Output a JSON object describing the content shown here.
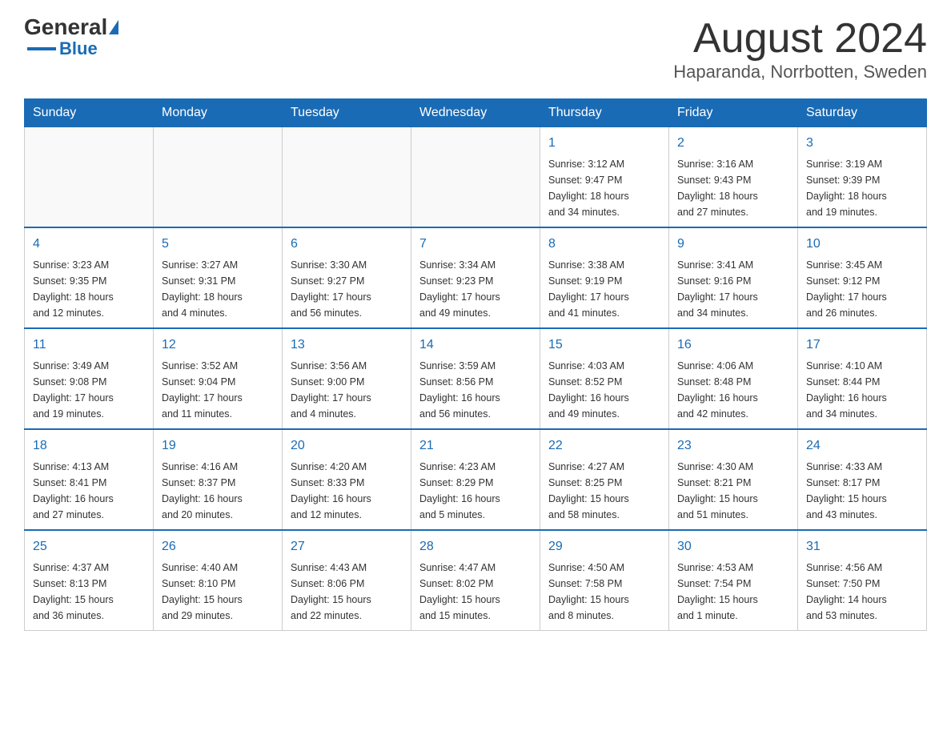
{
  "header": {
    "logo_general": "General",
    "logo_blue": "Blue",
    "month_title": "August 2024",
    "location": "Haparanda, Norrbotten, Sweden"
  },
  "weekdays": [
    "Sunday",
    "Monday",
    "Tuesday",
    "Wednesday",
    "Thursday",
    "Friday",
    "Saturday"
  ],
  "weeks": [
    [
      {
        "day": "",
        "info": ""
      },
      {
        "day": "",
        "info": ""
      },
      {
        "day": "",
        "info": ""
      },
      {
        "day": "",
        "info": ""
      },
      {
        "day": "1",
        "info": "Sunrise: 3:12 AM\nSunset: 9:47 PM\nDaylight: 18 hours\nand 34 minutes."
      },
      {
        "day": "2",
        "info": "Sunrise: 3:16 AM\nSunset: 9:43 PM\nDaylight: 18 hours\nand 27 minutes."
      },
      {
        "day": "3",
        "info": "Sunrise: 3:19 AM\nSunset: 9:39 PM\nDaylight: 18 hours\nand 19 minutes."
      }
    ],
    [
      {
        "day": "4",
        "info": "Sunrise: 3:23 AM\nSunset: 9:35 PM\nDaylight: 18 hours\nand 12 minutes."
      },
      {
        "day": "5",
        "info": "Sunrise: 3:27 AM\nSunset: 9:31 PM\nDaylight: 18 hours\nand 4 minutes."
      },
      {
        "day": "6",
        "info": "Sunrise: 3:30 AM\nSunset: 9:27 PM\nDaylight: 17 hours\nand 56 minutes."
      },
      {
        "day": "7",
        "info": "Sunrise: 3:34 AM\nSunset: 9:23 PM\nDaylight: 17 hours\nand 49 minutes."
      },
      {
        "day": "8",
        "info": "Sunrise: 3:38 AM\nSunset: 9:19 PM\nDaylight: 17 hours\nand 41 minutes."
      },
      {
        "day": "9",
        "info": "Sunrise: 3:41 AM\nSunset: 9:16 PM\nDaylight: 17 hours\nand 34 minutes."
      },
      {
        "day": "10",
        "info": "Sunrise: 3:45 AM\nSunset: 9:12 PM\nDaylight: 17 hours\nand 26 minutes."
      }
    ],
    [
      {
        "day": "11",
        "info": "Sunrise: 3:49 AM\nSunset: 9:08 PM\nDaylight: 17 hours\nand 19 minutes."
      },
      {
        "day": "12",
        "info": "Sunrise: 3:52 AM\nSunset: 9:04 PM\nDaylight: 17 hours\nand 11 minutes."
      },
      {
        "day": "13",
        "info": "Sunrise: 3:56 AM\nSunset: 9:00 PM\nDaylight: 17 hours\nand 4 minutes."
      },
      {
        "day": "14",
        "info": "Sunrise: 3:59 AM\nSunset: 8:56 PM\nDaylight: 16 hours\nand 56 minutes."
      },
      {
        "day": "15",
        "info": "Sunrise: 4:03 AM\nSunset: 8:52 PM\nDaylight: 16 hours\nand 49 minutes."
      },
      {
        "day": "16",
        "info": "Sunrise: 4:06 AM\nSunset: 8:48 PM\nDaylight: 16 hours\nand 42 minutes."
      },
      {
        "day": "17",
        "info": "Sunrise: 4:10 AM\nSunset: 8:44 PM\nDaylight: 16 hours\nand 34 minutes."
      }
    ],
    [
      {
        "day": "18",
        "info": "Sunrise: 4:13 AM\nSunset: 8:41 PM\nDaylight: 16 hours\nand 27 minutes."
      },
      {
        "day": "19",
        "info": "Sunrise: 4:16 AM\nSunset: 8:37 PM\nDaylight: 16 hours\nand 20 minutes."
      },
      {
        "day": "20",
        "info": "Sunrise: 4:20 AM\nSunset: 8:33 PM\nDaylight: 16 hours\nand 12 minutes."
      },
      {
        "day": "21",
        "info": "Sunrise: 4:23 AM\nSunset: 8:29 PM\nDaylight: 16 hours\nand 5 minutes."
      },
      {
        "day": "22",
        "info": "Sunrise: 4:27 AM\nSunset: 8:25 PM\nDaylight: 15 hours\nand 58 minutes."
      },
      {
        "day": "23",
        "info": "Sunrise: 4:30 AM\nSunset: 8:21 PM\nDaylight: 15 hours\nand 51 minutes."
      },
      {
        "day": "24",
        "info": "Sunrise: 4:33 AM\nSunset: 8:17 PM\nDaylight: 15 hours\nand 43 minutes."
      }
    ],
    [
      {
        "day": "25",
        "info": "Sunrise: 4:37 AM\nSunset: 8:13 PM\nDaylight: 15 hours\nand 36 minutes."
      },
      {
        "day": "26",
        "info": "Sunrise: 4:40 AM\nSunset: 8:10 PM\nDaylight: 15 hours\nand 29 minutes."
      },
      {
        "day": "27",
        "info": "Sunrise: 4:43 AM\nSunset: 8:06 PM\nDaylight: 15 hours\nand 22 minutes."
      },
      {
        "day": "28",
        "info": "Sunrise: 4:47 AM\nSunset: 8:02 PM\nDaylight: 15 hours\nand 15 minutes."
      },
      {
        "day": "29",
        "info": "Sunrise: 4:50 AM\nSunset: 7:58 PM\nDaylight: 15 hours\nand 8 minutes."
      },
      {
        "day": "30",
        "info": "Sunrise: 4:53 AM\nSunset: 7:54 PM\nDaylight: 15 hours\nand 1 minute."
      },
      {
        "day": "31",
        "info": "Sunrise: 4:56 AM\nSunset: 7:50 PM\nDaylight: 14 hours\nand 53 minutes."
      }
    ]
  ]
}
